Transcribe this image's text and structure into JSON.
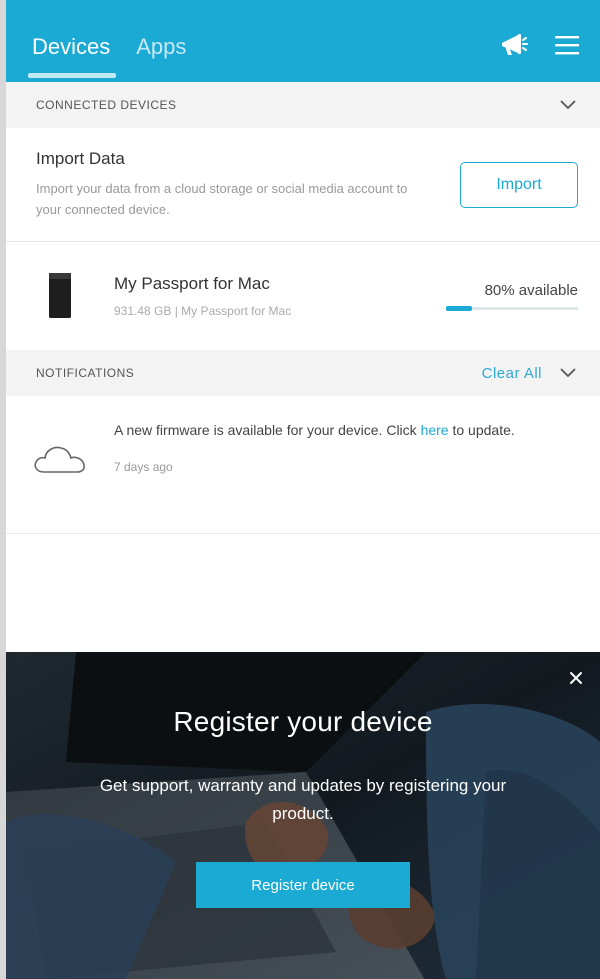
{
  "header": {
    "tabs": [
      {
        "label": "Devices",
        "active": true
      },
      {
        "label": "Apps",
        "active": false
      }
    ],
    "icons": [
      "megaphone-icon",
      "hamburger-menu-icon"
    ]
  },
  "connected_devices": {
    "title": "CONNECTED DEVICES",
    "import": {
      "title": "Import Data",
      "description": "Import your data from a cloud storage or social media account to your connected device.",
      "button_label": "Import"
    },
    "device": {
      "name": "My Passport for Mac",
      "subtitle": "931.48 GB | My Passport for Mac",
      "available_text": "80% available",
      "used_fraction": 0.2
    }
  },
  "notifications": {
    "title": "NOTIFICATIONS",
    "clear_all_label": "Clear All",
    "items": [
      {
        "text_before": "A new firmware is available for your device. Click ",
        "link_text": "here",
        "text_after": " to update.",
        "time": "7 days ago"
      }
    ]
  },
  "register_banner": {
    "title": "Register your device",
    "subtitle": "Get support, warranty and updates by registering your product.",
    "button_label": "Register device"
  },
  "colors": {
    "accent": "#1aaad3",
    "header_bg": "#1aaad3",
    "section_bg": "#f3f3f3"
  }
}
